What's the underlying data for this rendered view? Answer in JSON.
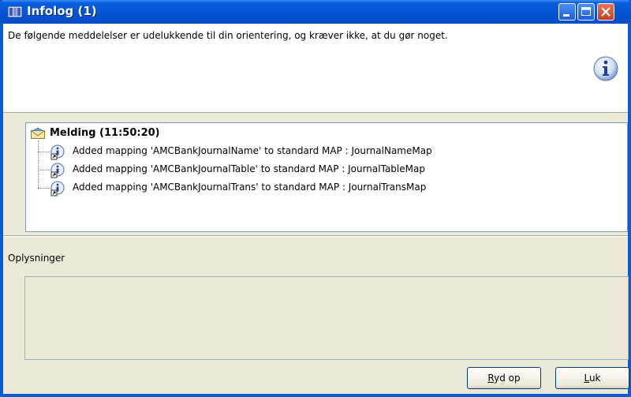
{
  "window": {
    "title": "Infolog (1)",
    "icon": "infolog-window-icon",
    "controls": [
      "minimize-icon",
      "maximize-icon",
      "close-icon"
    ]
  },
  "header": {
    "message": "De følgende meddelelser er udelukkende til din orientering, og kræver ikke, at du gør noget.",
    "icon": "info-icon"
  },
  "tree": {
    "root": {
      "label": "Melding (11:50:20)",
      "icon": "envelope-icon"
    },
    "items": [
      {
        "text": "Added mapping 'AMCBankJournalName' to standard MAP : JournalNameMap",
        "icon": "info-link-icon"
      },
      {
        "text": "Added mapping 'AMCBankJournalTable' to standard MAP : JournalTableMap",
        "icon": "info-link-icon"
      },
      {
        "text": "Added mapping 'AMCBankJournalTrans' to standard MAP : JournalTransMap",
        "icon": "info-link-icon"
      }
    ]
  },
  "details": {
    "label": "Oplysninger",
    "value": ""
  },
  "buttons": {
    "ryd_op": {
      "accel": "R",
      "rest": "yd op"
    },
    "luk": {
      "accel": "L",
      "rest": "uk"
    }
  },
  "colors": {
    "titlebar": "#0556d9",
    "frame": "#0a5cd6",
    "face": "#ece9d8"
  }
}
